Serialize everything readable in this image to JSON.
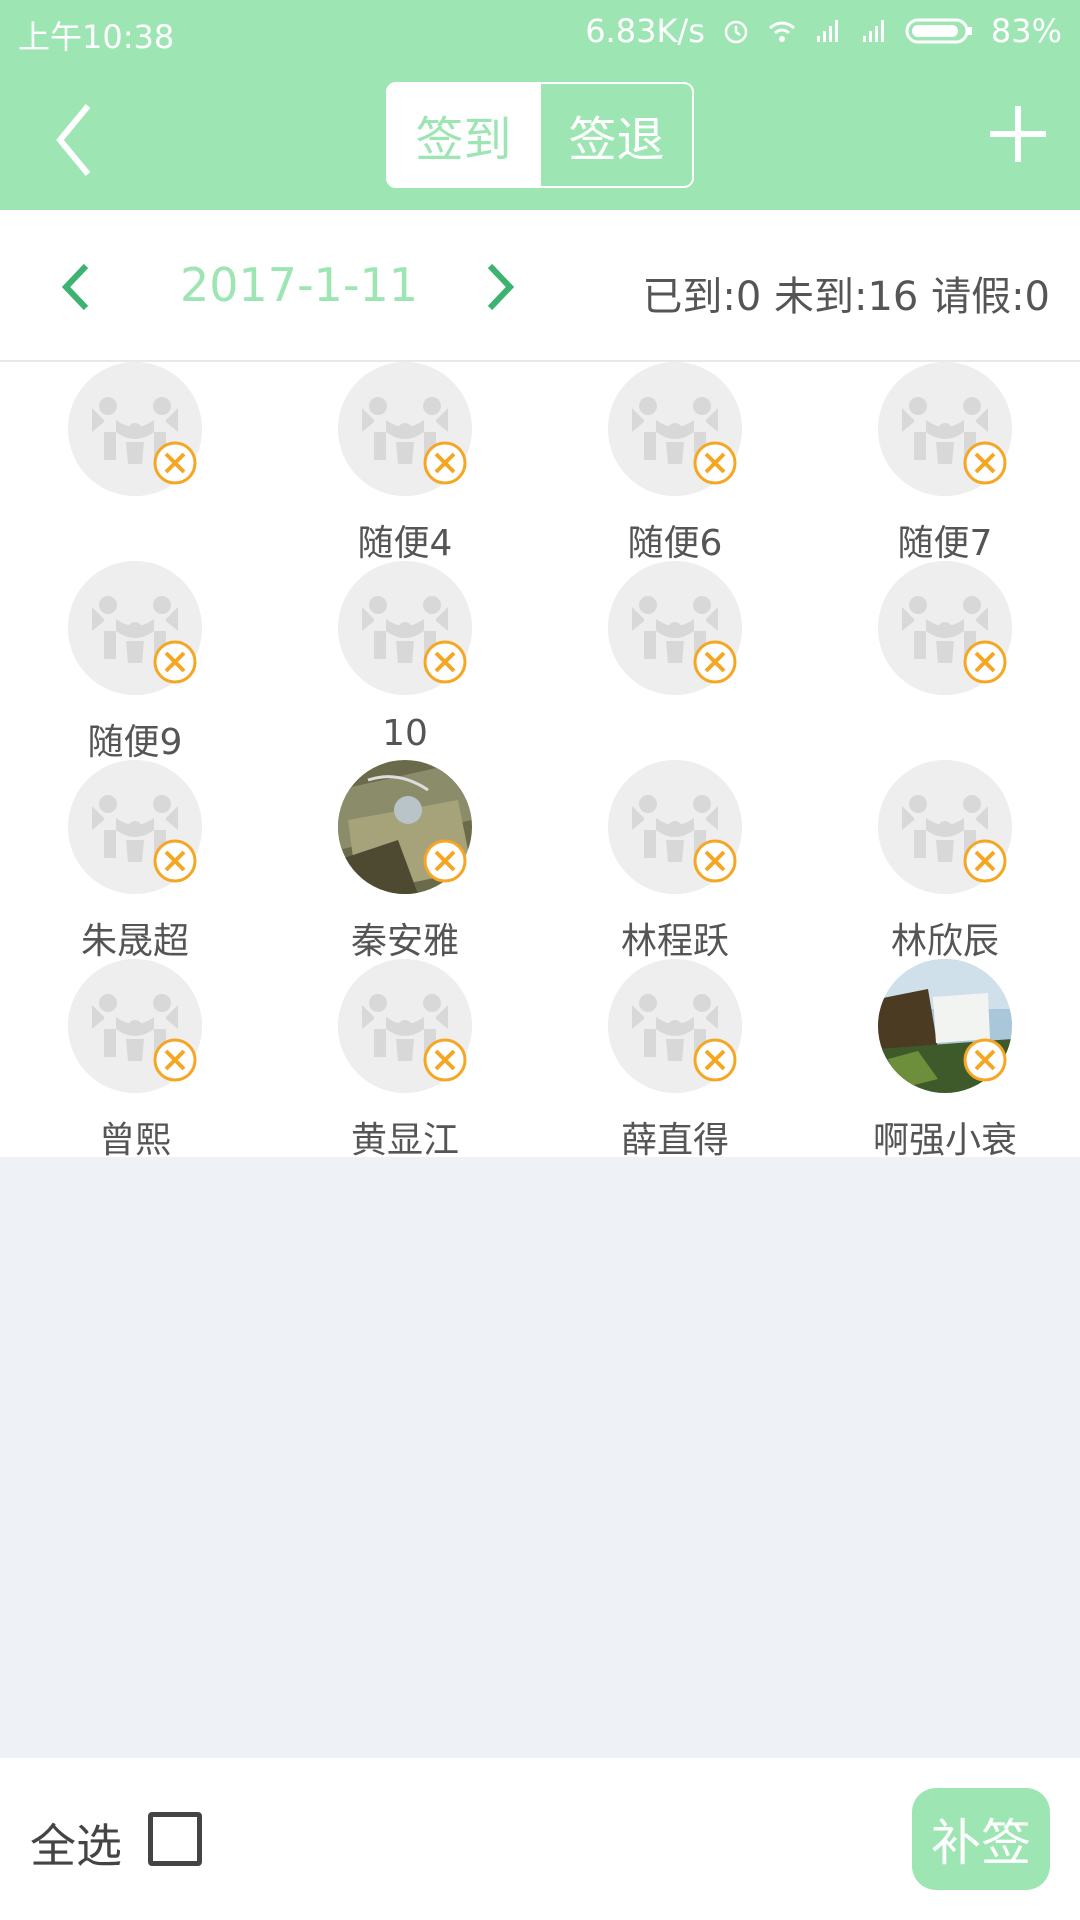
{
  "status_bar": {
    "time": "上午10:38",
    "speed": "6.83K/s",
    "battery": "83%",
    "icons": [
      "alarm-icon",
      "wifi-icon",
      "signal-icon",
      "signal-icon",
      "battery-icon"
    ]
  },
  "header": {
    "tabs": [
      {
        "label": "签到",
        "active": true
      },
      {
        "label": "签退",
        "active": false
      }
    ],
    "back_icon": "back-chevron-icon",
    "add_icon": "plus-icon"
  },
  "date_bar": {
    "date": "2017-1-11",
    "stats": "已到:0 未到:16 请假:0"
  },
  "people": [
    {
      "name": "",
      "avatar": "default"
    },
    {
      "name": "随便4",
      "avatar": "default"
    },
    {
      "name": "随便6",
      "avatar": "default"
    },
    {
      "name": "随便7",
      "avatar": "default"
    },
    {
      "name": "随便9",
      "avatar": "default"
    },
    {
      "name": "10",
      "avatar": "default"
    },
    {
      "name": "",
      "avatar": "default"
    },
    {
      "name": "",
      "avatar": "default"
    },
    {
      "name": "朱晟超",
      "avatar": "default"
    },
    {
      "name": "秦安雅",
      "avatar": "photo-bag"
    },
    {
      "name": "林程跃",
      "avatar": "default"
    },
    {
      "name": "林欣辰",
      "avatar": "default"
    },
    {
      "name": "曾熙",
      "avatar": "default"
    },
    {
      "name": "黄显江",
      "avatar": "default"
    },
    {
      "name": "薛直得",
      "avatar": "default"
    },
    {
      "name": "啊强小衰",
      "avatar": "photo-waterfall"
    }
  ],
  "bottom_bar": {
    "select_all": "全选",
    "supplement": "补签"
  },
  "colors": {
    "accent": "#9de6b4",
    "badge": "#f5a623",
    "background": "#eef1f5"
  }
}
